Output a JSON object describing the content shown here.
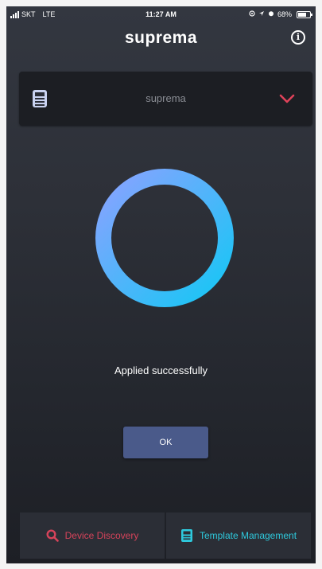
{
  "status_bar": {
    "carrier": "SKT",
    "network": "LTE",
    "time": "11:27 AM",
    "battery_percent": "68%",
    "battery_level": 0.68
  },
  "header": {
    "brand": "suprema",
    "info_icon": "info-icon"
  },
  "device_selector": {
    "selected": "suprema",
    "icon": "device-icon",
    "chevron": "chevron-down-icon",
    "chevron_color": "#e0425a"
  },
  "progress": {
    "ring_icon": "success-ring",
    "gradient_start": "#8aa2ff",
    "gradient_end": "#15c7f5"
  },
  "message": "Applied successfully",
  "ok_button": "OK",
  "tabs": [
    {
      "label": "Device Discovery",
      "icon": "search-icon",
      "color": "#d6435a"
    },
    {
      "label": "Template Management",
      "icon": "template-icon",
      "color": "#2ec9dd"
    }
  ]
}
